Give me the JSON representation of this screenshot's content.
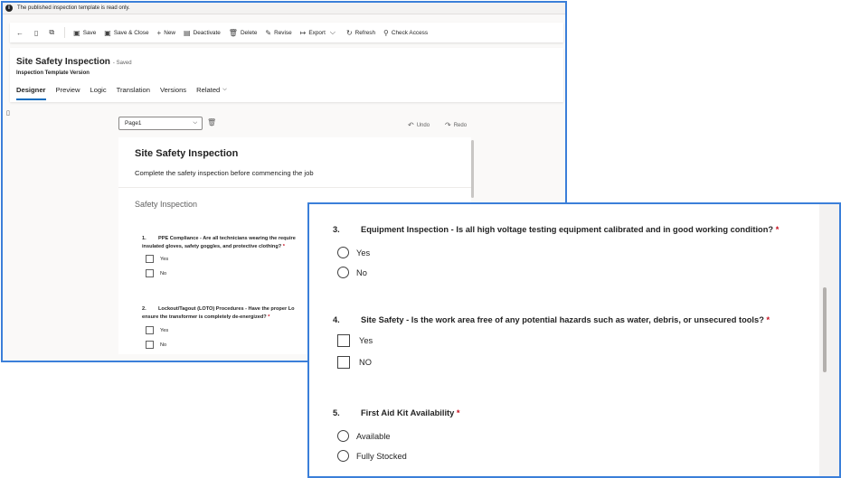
{
  "infobar": {
    "text": "The published inspection template is read only."
  },
  "commandbar": {
    "save": "Save",
    "save_close": "Save & Close",
    "new": "New",
    "deactivate": "Deactivate",
    "delete": "Delete",
    "revise": "Revise",
    "export": "Export",
    "refresh": "Refresh",
    "check_access": "Check Access"
  },
  "record": {
    "title": "Site Safety Inspection",
    "status": "- Saved",
    "entity": "Inspection Template Version"
  },
  "tabs": [
    "Designer",
    "Preview",
    "Logic",
    "Translation",
    "Versions",
    "Related"
  ],
  "designer": {
    "page_select": "Page1",
    "undo": "Undo",
    "redo": "Redo"
  },
  "form": {
    "title": "Site Safety Inspection",
    "description": "Complete the safety inspection before commencing the job",
    "section": "Safety Inspection",
    "q1": {
      "num": "1.",
      "line1": "PPE Compliance - Are all technicians wearing the require",
      "line2": "insulated gloves, safety goggles, and protective clothing?",
      "req": "*",
      "options": [
        "Yes",
        "No"
      ]
    },
    "q2": {
      "num": "2.",
      "line1": "Lockout/Tagout (LOTO) Procedures - Have the proper Lo",
      "line2": "ensure the transformer is completely de-energized?",
      "req": "*",
      "options": [
        "Yes",
        "No"
      ]
    }
  },
  "zoom": {
    "q3": {
      "num": "3.",
      "text": "Equipment Inspection - Is all high voltage testing equipment calibrated and in good working condition?",
      "req": "*",
      "options": [
        "Yes",
        "No"
      ]
    },
    "q4": {
      "num": "4.",
      "text": "Site Safety - Is the work area free of any potential hazards such as water, debris, or unsecured tools?",
      "req": "*",
      "options": [
        "Yes",
        "NO"
      ]
    },
    "q5": {
      "num": "5.",
      "text": "First Aid Kit Availability",
      "req": "*",
      "options": [
        "Available",
        "Fully Stocked"
      ]
    }
  }
}
